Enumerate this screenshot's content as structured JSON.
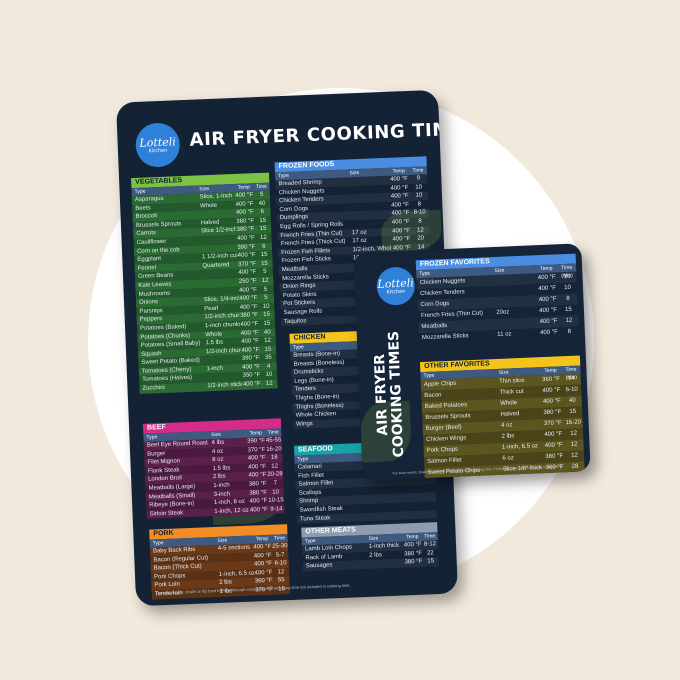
{
  "brand": {
    "name": "Lotteli",
    "tagline": "Kitchen"
  },
  "big": {
    "title": "AIR FRYER COOKING TIMES",
    "footer": "For best results, shake or flip food halfway through cooking time. Preheating time not included in cooking time.",
    "vegetables": {
      "title": "VEGETABLES",
      "cols": [
        "Type",
        "Size",
        "Temp",
        "Time"
      ],
      "rows": [
        [
          "Asparagus",
          "Slice, 1-inch",
          "400 °F",
          "5"
        ],
        [
          "Beets",
          "Whole",
          "400 °F",
          "40"
        ],
        [
          "Broccoli",
          "",
          "400 °F",
          "6"
        ],
        [
          "Brussels Sprouts",
          "Halved",
          "380 °F",
          "15"
        ],
        [
          "Carrots",
          "Slice 1/2-inch",
          "380 °F",
          "15"
        ],
        [
          "Cauliflower",
          "",
          "400 °F",
          "12"
        ],
        [
          "Corn on the cob",
          "",
          "390 °F",
          "6"
        ],
        [
          "Eggplant",
          "1 1/2-inch cubes",
          "400 °F",
          "15"
        ],
        [
          "Fennel",
          "Quartered",
          "370 °F",
          "15"
        ],
        [
          "Green Beans",
          "",
          "400 °F",
          "5"
        ],
        [
          "Kale Leaves",
          "",
          "250 °F",
          "12"
        ],
        [
          "Mushrooms",
          "",
          "400 °F",
          "5"
        ],
        [
          "Onions",
          "Slice, 1/4-inch",
          "400 °F",
          "5"
        ],
        [
          "Parsnips",
          "Pearl",
          "400 °F",
          "10"
        ],
        [
          "Peppers",
          "1/2-inch chunks",
          "380 °F",
          "15"
        ],
        [
          "Potatoes (Baked)",
          "1-inch chunks",
          "400 °F",
          "15"
        ],
        [
          "Potatoes (Chunks)",
          "Whole",
          "400 °F",
          "40"
        ],
        [
          "Potatoes (Small Baby)",
          "1.5 lbs",
          "400 °F",
          "12"
        ],
        [
          "Squash",
          "1/2-inch chunks",
          "400 °F",
          "15"
        ],
        [
          "Sweet Potato (Baked)",
          "",
          "390 °F",
          "35"
        ],
        [
          "Tomatoes (Cherry)",
          "1-inch",
          "400 °F",
          "4"
        ],
        [
          "Tomatoes (Halves)",
          "",
          "350 °F",
          "10"
        ],
        [
          "Zucchini",
          "1/2-inch sticks",
          "400 °F",
          "12"
        ]
      ]
    },
    "frozen": {
      "title": "FROZEN FOODS",
      "cols": [
        "Type",
        "Size",
        "Temp",
        "Time"
      ],
      "rows": [
        [
          "Breaded Shrimp",
          "",
          "400 °F",
          "9"
        ],
        [
          "Chicken Nuggets",
          "",
          "400 °F",
          "10"
        ],
        [
          "Chicken Tenders",
          "",
          "400 °F",
          "10"
        ],
        [
          "Corn Dogs",
          "",
          "400 °F",
          "8"
        ],
        [
          "Dumplings",
          "",
          "400 °F",
          "8-10"
        ],
        [
          "Egg Rolls / Spring Rolls",
          "",
          "400 °F",
          "8"
        ],
        [
          "French Fries (Thin Cut)",
          "17 oz",
          "400 °F",
          "12"
        ],
        [
          "French Fries (Thick Cut)",
          "17 oz",
          "400 °F",
          "20"
        ],
        [
          "Frozen Fish Fillets",
          "1/2-inch, Whole",
          "400 °F",
          "14"
        ],
        [
          "Frozen Fish Sticks",
          "10 oz",
          "400 °F",
          "10"
        ],
        [
          "Meatballs",
          "",
          "400 °F",
          "10"
        ],
        [
          "Mozzarella Sticks",
          "11 oz",
          "400 °F",
          "8"
        ],
        [
          "Onion Rings",
          "12 oz",
          "400 °F",
          "8"
        ],
        [
          "Potato Skins",
          "",
          "400 °F",
          "8"
        ],
        [
          "Pot Stickers",
          "",
          "400 °F",
          "8"
        ],
        [
          "Sausage Rolls",
          "",
          "400 °F",
          "8"
        ],
        [
          "Taquitos",
          "",
          "400 °F",
          "8"
        ]
      ]
    },
    "beef": {
      "title": "BEEF",
      "cols": [
        "Type",
        "Size",
        "Temp",
        "Time"
      ],
      "rows": [
        [
          "Beef Eye Round Roast",
          "4 lbs",
          "390 °F",
          "45-55"
        ],
        [
          "Burger",
          "4 oz",
          "370 °F",
          "16-20"
        ],
        [
          "Filet Mignon",
          "8 oz",
          "400 °F",
          "18"
        ],
        [
          "Flank Steak",
          "1.5 lbs",
          "400 °F",
          "12"
        ],
        [
          "London Broil",
          "2 lbs",
          "400 °F",
          "20-28"
        ],
        [
          "Meatballs (Large)",
          "1-inch",
          "380 °F",
          "7"
        ],
        [
          "Meatballs (Small)",
          "3-inch",
          "380 °F",
          "10"
        ],
        [
          "Ribeye (Bone-in)",
          "1-inch, 8 oz",
          "400 °F",
          "10-15"
        ],
        [
          "Sirloin Steak",
          "1-inch, 12 oz",
          "400 °F",
          "9-14"
        ]
      ]
    },
    "chicken": {
      "title": "CHICKEN",
      "cols": [
        "Type",
        "Size",
        "Temp",
        "Time"
      ],
      "rows": [
        [
          "Breasts (Bone-in)",
          "",
          "",
          ""
        ],
        [
          "Breasts (Boneless)",
          "",
          "",
          ""
        ],
        [
          "Drumsticks",
          "",
          "",
          ""
        ],
        [
          "Legs (Bone-in)",
          "",
          "",
          ""
        ],
        [
          "Tenders",
          "",
          "",
          ""
        ],
        [
          "Thighs (Bone-in)",
          "",
          "",
          ""
        ],
        [
          "Thighs (Boneless)",
          "",
          "",
          ""
        ],
        [
          "Whole Chicken",
          "",
          "",
          ""
        ],
        [
          "Wings",
          "",
          "",
          ""
        ]
      ]
    },
    "seafood": {
      "title": "SEAFOOD",
      "cols": [
        "Type",
        "Size",
        "Temp",
        "Time"
      ],
      "rows": [
        [
          "Calamari",
          "",
          "",
          ""
        ],
        [
          "Fish Fillet",
          "",
          "",
          ""
        ],
        [
          "Salmon Fillet",
          "",
          "",
          ""
        ],
        [
          "Scallops",
          "",
          "",
          ""
        ],
        [
          "Shrimp",
          "",
          "",
          ""
        ],
        [
          "Swordfish Steak",
          "",
          "",
          ""
        ],
        [
          "Tuna Steak",
          "",
          "",
          ""
        ]
      ]
    },
    "pork": {
      "title": "PORK",
      "cols": [
        "Type",
        "Size",
        "Temp",
        "Time"
      ],
      "rows": [
        [
          "Baby Back Ribs",
          "4-5 sections",
          "400 °F",
          "25-30"
        ],
        [
          "Bacon (Regular Cut)",
          "",
          "400 °F",
          "5-7"
        ],
        [
          "Bacon (Thick Cut)",
          "",
          "400 °F",
          "6-10"
        ],
        [
          "Pork Chops",
          "1-inch, 6.5 oz",
          "400 °F",
          "12"
        ],
        [
          "Pork Loin",
          "2 lbs",
          "360 °F",
          "55"
        ],
        [
          "Tenderloin",
          "1 lbs",
          "370 °F",
          "15"
        ]
      ]
    },
    "othermeats": {
      "title": "OTHER MEATS",
      "cols": [
        "Type",
        "Size",
        "Temp",
        "Time"
      ],
      "rows": [
        [
          "Lamb Loin Chops",
          "1-inch thick",
          "400 °F",
          "8-12"
        ],
        [
          "Rack of Lamb",
          "2 lbs",
          "380 °F",
          "22"
        ],
        [
          "Sausages",
          "",
          "380 °F",
          "15"
        ]
      ]
    }
  },
  "small": {
    "title_line1": "AIR FRYER",
    "title_line2": "COOKING TIMES",
    "footer": "For best results, shake or flip food halfway through cooking time. Preheating time not included in cooking time.",
    "frozen_favorites": {
      "title": "FROZEN FAVORITES",
      "cols": [
        "Type",
        "Size",
        "Temp",
        "Time (Min)"
      ],
      "rows": [
        [
          "Chicken Nuggets",
          "",
          "400 °F",
          "10"
        ],
        [
          "Chicken Tenders",
          "",
          "400 °F",
          "10"
        ],
        [
          "Corn Dogs",
          "",
          "400 °F",
          "8"
        ],
        [
          "French Fries (Thin Cut)",
          "20oz",
          "400 °F",
          "15"
        ],
        [
          "Meatballs",
          "",
          "400 °F",
          "12"
        ],
        [
          "Mozzarella Sticks",
          "11 oz",
          "400 °F",
          "8"
        ]
      ]
    },
    "other_favorites": {
      "title": "OTHER FAVORITES",
      "cols": [
        "Type",
        "Size",
        "Temp",
        "Time (Min)"
      ],
      "rows": [
        [
          "Apple Chips",
          "Thin slice",
          "360 °F",
          "14"
        ],
        [
          "Bacon",
          "Thick cut",
          "400 °F",
          "6-10"
        ],
        [
          "Baked Potatoes",
          "Whole",
          "400 °F",
          "40"
        ],
        [
          "Brussels Sprouts",
          "Halved",
          "380 °F",
          "15"
        ],
        [
          "Burger (Beef)",
          "4 oz",
          "370 °F",
          "16-20"
        ],
        [
          "Chicken Wings",
          "2 lbs",
          "400 °F",
          "12"
        ],
        [
          "Pork Chops",
          "1-inch, 6.5 oz",
          "400 °F",
          "12"
        ],
        [
          "Salmon Fillet",
          "6 oz",
          "380 °F",
          "12"
        ],
        [
          "Sweet Potato Chips",
          "Slice 1/8\" thick",
          "360 °F",
          "28"
        ]
      ]
    }
  }
}
